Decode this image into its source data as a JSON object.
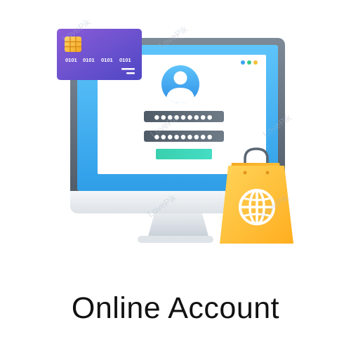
{
  "caption": "Online Account",
  "card": {
    "number_groups": [
      "0101",
      "0101",
      "0101",
      "0101"
    ]
  },
  "login_form": {
    "password_mask": "●●●●●●●●●"
  },
  "watermark": "LovePik",
  "icons": {
    "card": "credit-card-icon",
    "user": "user-avatar-icon",
    "bag": "shopping-bag-icon",
    "globe": "globe-icon",
    "monitor": "monitor-icon"
  },
  "colors": {
    "card_purple": "#6c4ec8",
    "screen_blue": "#3db0f2",
    "bag_yellow": "#ffc53d",
    "field_gray": "#5f6b76",
    "submit_teal": "#3dd3b4",
    "dot_blue": "#3aa2f0",
    "dot_green": "#39c98a",
    "dot_yellow": "#f6c13b"
  }
}
